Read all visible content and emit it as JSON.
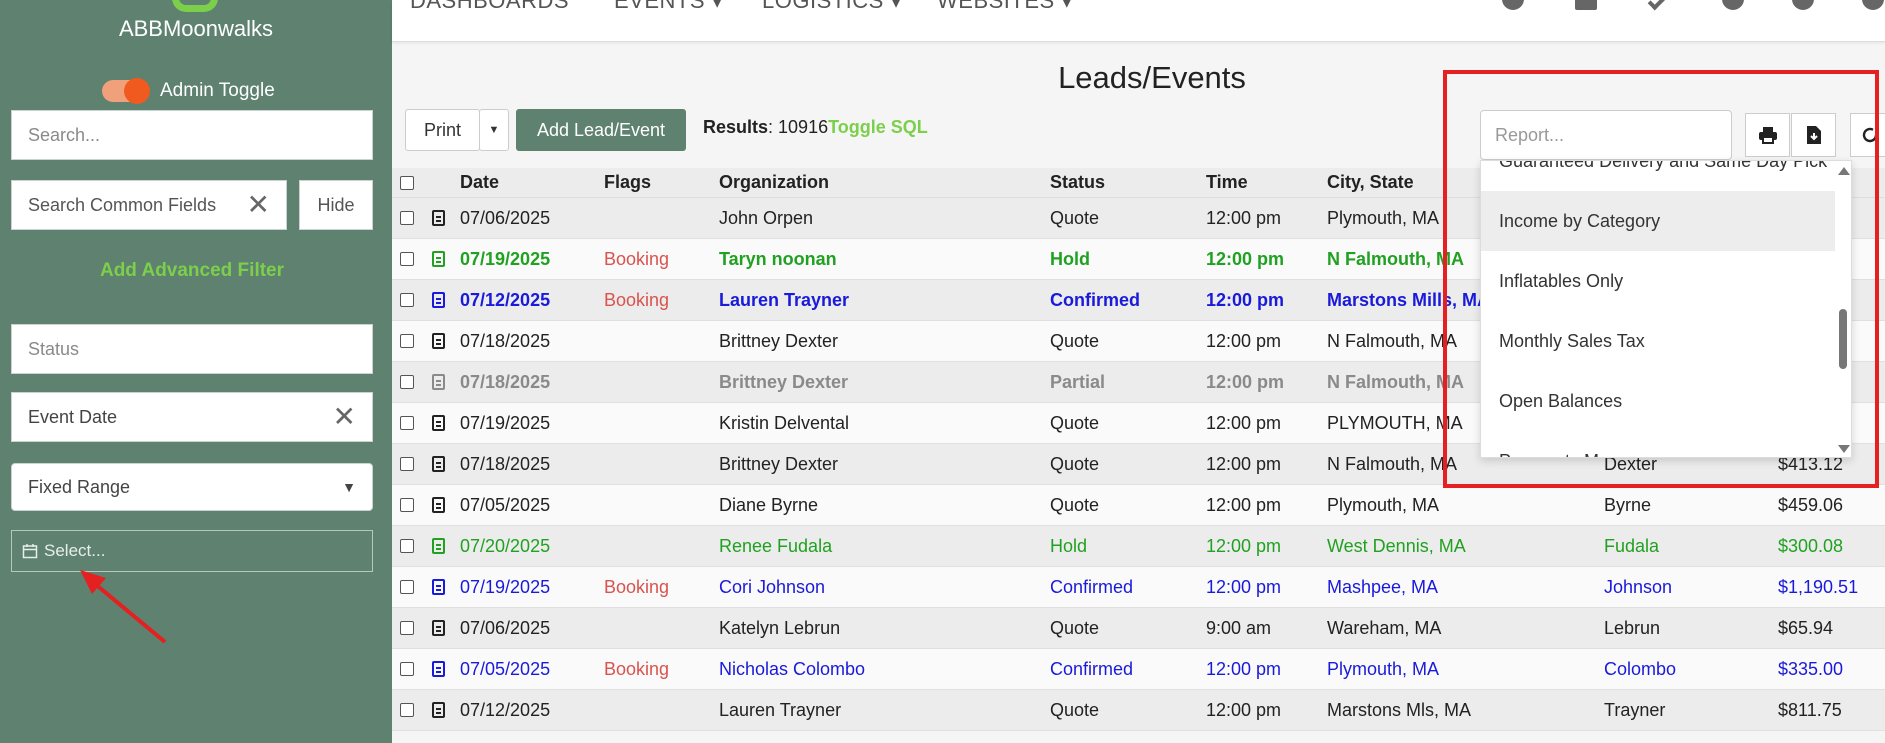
{
  "sidebar": {
    "brand": "ABBMoonwalks",
    "admin_toggle_label": "Admin Toggle",
    "search_placeholder": "Search...",
    "common_fields_value": "Search Common Fields",
    "hide_label": "Hide",
    "advanced_filter_label": "Add Advanced Filter",
    "status_placeholder": "Status",
    "event_date_value": "Event Date",
    "range_value": "Fixed Range",
    "date_select_placeholder": "Select..."
  },
  "topnav": {
    "items": [
      "DASHBOARDS",
      "EVENTS ▾",
      "LOGISTICS ▾",
      "WEBSITES ▾"
    ]
  },
  "main": {
    "title": "Leads/Events",
    "print_label": "Print",
    "add_label": "Add Lead/Event",
    "results_label": "Results",
    "results_count": ": 10916",
    "toggle_sql_label": "Toggle SQL",
    "report_placeholder": "Report..."
  },
  "table": {
    "headers": [
      "Date",
      "Flags",
      "Organization",
      "Status",
      "Time",
      "City, State"
    ],
    "rows": [
      {
        "date": "07/06/2025",
        "flag": "",
        "org": "John Orpen",
        "status": "Quote",
        "time": "12:00 pm",
        "city": "Plymouth, MA",
        "last": "",
        "amount": "",
        "style": "normal"
      },
      {
        "date": "07/19/2025",
        "flag": "Booking",
        "org": "Taryn noonan",
        "status": "Hold",
        "time": "12:00 pm",
        "city": "N Falmouth, MA",
        "last": "",
        "amount": "",
        "style": "green-bold"
      },
      {
        "date": "07/12/2025",
        "flag": "Booking",
        "org": "Lauren Trayner",
        "status": "Confirmed",
        "time": "12:00 pm",
        "city": "Marstons Mills, MA",
        "last": "",
        "amount": "",
        "style": "blue-bold"
      },
      {
        "date": "07/18/2025",
        "flag": "",
        "org": "Brittney Dexter",
        "status": "Quote",
        "time": "12:00 pm",
        "city": "N Falmouth, MA",
        "last": "",
        "amount": "",
        "style": "normal"
      },
      {
        "date": "07/18/2025",
        "flag": "",
        "org": "Brittney Dexter",
        "status": "Partial",
        "time": "12:00 pm",
        "city": "N Falmouth, MA",
        "last": "",
        "amount": "",
        "style": "gray-bold"
      },
      {
        "date": "07/19/2025",
        "flag": "",
        "org": "Kristin Delvental",
        "status": "Quote",
        "time": "12:00 pm",
        "city": "PLYMOUTH, MA",
        "last": "",
        "amount": "",
        "style": "normal"
      },
      {
        "date": "07/18/2025",
        "flag": "",
        "org": "Brittney Dexter",
        "status": "Quote",
        "time": "12:00 pm",
        "city": "N Falmouth, MA",
        "last": "Dexter",
        "amount": "$413.12",
        "style": "normal"
      },
      {
        "date": "07/05/2025",
        "flag": "",
        "org": "Diane Byrne",
        "status": "Quote",
        "time": "12:00 pm",
        "city": "Plymouth, MA",
        "last": "Byrne",
        "amount": "$459.06",
        "style": "normal"
      },
      {
        "date": "07/20/2025",
        "flag": "",
        "org": "Renee Fudala",
        "status": "Hold",
        "time": "12:00 pm",
        "city": "West Dennis, MA",
        "last": "Fudala",
        "amount": "$300.08",
        "style": "green"
      },
      {
        "date": "07/19/2025",
        "flag": "Booking",
        "org": "Cori Johnson",
        "status": "Confirmed",
        "time": "12:00 pm",
        "city": "Mashpee, MA",
        "last": "Johnson",
        "amount": "$1,190.51",
        "style": "blue"
      },
      {
        "date": "07/06/2025",
        "flag": "",
        "org": "Katelyn Lebrun",
        "status": "Quote",
        "time": "9:00 am",
        "city": "Wareham, MA",
        "last": "Lebrun",
        "amount": "$65.94",
        "style": "normal"
      },
      {
        "date": "07/05/2025",
        "flag": "Booking",
        "org": "Nicholas Colombo",
        "status": "Confirmed",
        "time": "12:00 pm",
        "city": "Plymouth, MA",
        "last": "Colombo",
        "amount": "$335.00",
        "style": "blue"
      },
      {
        "date": "07/12/2025",
        "flag": "",
        "org": "Lauren Trayner",
        "status": "Quote",
        "time": "12:00 pm",
        "city": "Marstons Mls, MA",
        "last": "Trayner",
        "amount": "$811.75",
        "style": "normal"
      }
    ]
  },
  "report_dropdown": {
    "items": [
      "Guaranteed Delivery and Same Day Pick",
      "Income by Category",
      "Inflatables Only",
      "Monthly Sales Tax",
      "Open Balances",
      "Payments Ma"
    ],
    "highlighted_index": 1
  },
  "colors": {
    "sidebar": "#5e8170",
    "accent_green": "#7ccf4b",
    "row_green": "#21a121",
    "row_blue": "#1a1adb",
    "row_gray": "#8a8a8a",
    "flag_red": "#d9534f",
    "annotation_red": "#e52020"
  }
}
